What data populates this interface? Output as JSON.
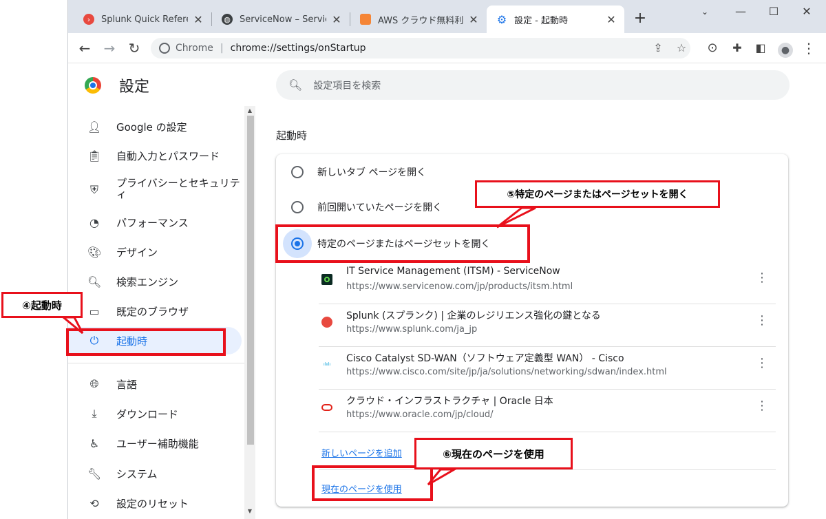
{
  "tabs": [
    {
      "title": "Splunk Quick Referen",
      "favicon": "splunk-icon"
    },
    {
      "title": "ServiceNow – Service",
      "favicon": "globe-icon"
    },
    {
      "title": "AWS クラウド無料利用",
      "favicon": "aws-icon"
    },
    {
      "title": "設定 - 起動時",
      "favicon": "gear-icon"
    }
  ],
  "toolbar": {
    "site_label": "Chrome",
    "url": "chrome://settings/onStartup"
  },
  "settings": {
    "title": "設定",
    "search_placeholder": "設定項目を検索"
  },
  "sidebar": {
    "items": [
      {
        "label": "Google の設定",
        "icon": "person-icon"
      },
      {
        "label": "自動入力とパスワード",
        "icon": "clipboard-icon"
      },
      {
        "label": "プライバシーとセキュリティ",
        "icon": "shield-icon"
      },
      {
        "label": "パフォーマンス",
        "icon": "speedometer-icon"
      },
      {
        "label": "デザイン",
        "icon": "palette-icon"
      },
      {
        "label": "検索エンジン",
        "icon": "search-icon"
      },
      {
        "label": "既定のブラウザ",
        "icon": "browser-icon"
      },
      {
        "label": "起動時",
        "icon": "power-icon"
      },
      {
        "label": "言語",
        "icon": "globe-icon"
      },
      {
        "label": "ダウンロード",
        "icon": "download-icon"
      },
      {
        "label": "ユーザー補助機能",
        "icon": "accessibility-icon"
      },
      {
        "label": "システム",
        "icon": "wrench-icon"
      },
      {
        "label": "設定のリセット",
        "icon": "reset-icon"
      }
    ],
    "active_index": 7
  },
  "startup": {
    "section_title": "起動時",
    "options": [
      {
        "label": "新しいタブ ページを開く",
        "checked": false
      },
      {
        "label": "前回開いていたページを開く",
        "checked": false
      },
      {
        "label": "特定のページまたはページセットを開く",
        "checked": true
      }
    ],
    "pages": [
      {
        "title": "IT Service Management (ITSM) - ServiceNow",
        "url": "https://www.servicenow.com/jp/products/itsm.html",
        "favicon": "servicenow-icon"
      },
      {
        "title": "Splunk (スプランク) | 企業のレジリエンス強化の鍵となる",
        "url": "https://www.splunk.com/ja_jp",
        "favicon": "splunk-icon"
      },
      {
        "title": "Cisco Catalyst SD-WAN（ソフトウェア定義型 WAN） - Cisco",
        "url": "https://www.cisco.com/site/jp/ja/solutions/networking/sdwan/index.html",
        "favicon": "cisco-icon"
      },
      {
        "title": "クラウド・インフラストラクチャ | Oracle 日本",
        "url": "https://www.oracle.com/jp/cloud/",
        "favicon": "oracle-icon"
      }
    ],
    "add_page_link": "新しいページを追加",
    "use_current_link": "現在のページを使用"
  },
  "annotations": {
    "callout4": "④起動時",
    "callout5": "⑤特定のページまたはページセットを開く",
    "callout6": "⑥現在のページを使用",
    "color": "#e8101b"
  },
  "colors": {
    "accent": "#1a73e8",
    "tabstrip": "#dee3eb",
    "active_nav_bg": "#e8f0fe"
  }
}
